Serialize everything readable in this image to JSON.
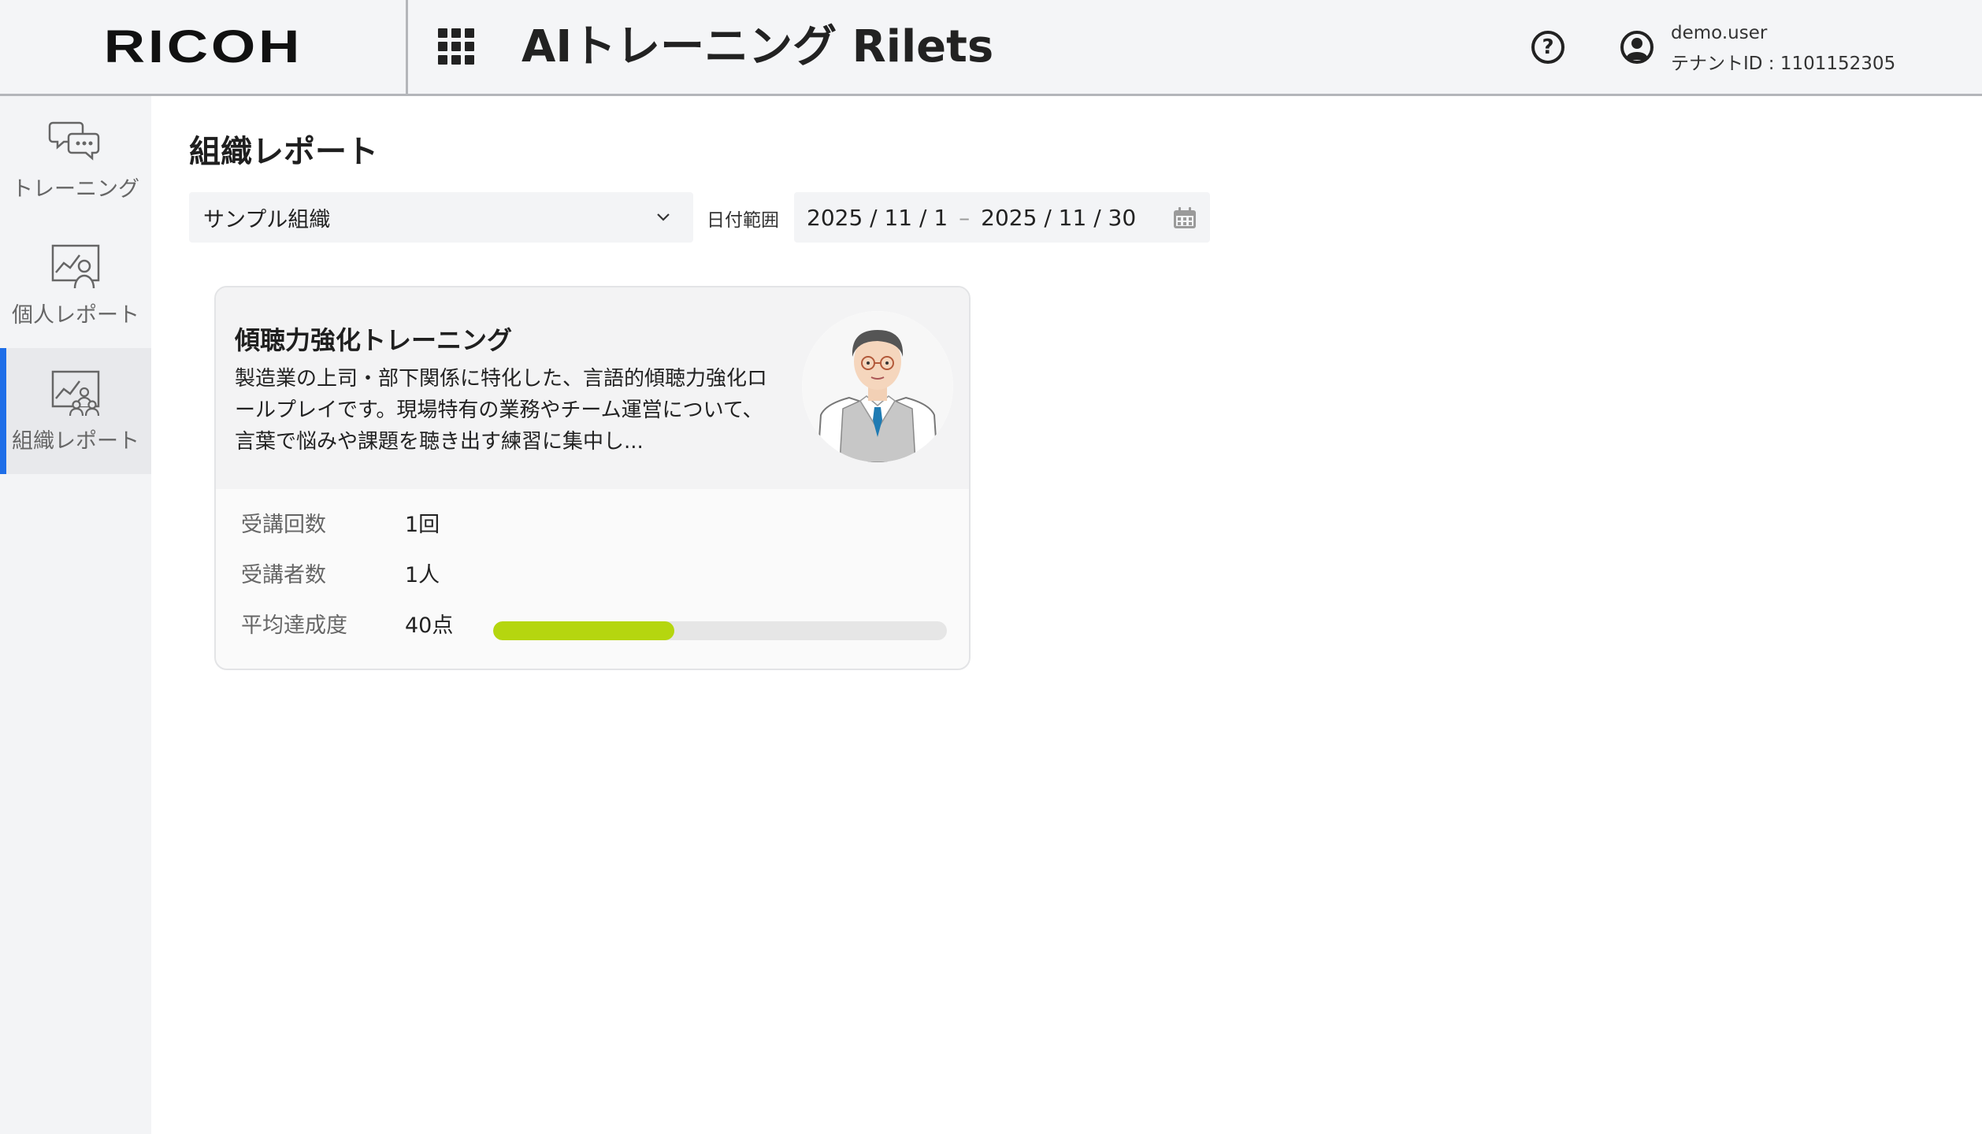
{
  "header": {
    "logo": "RICOH",
    "app_title": "AIトレーニング Rilets",
    "help_icon": "help-circle-icon",
    "user_icon": "user-circle-icon",
    "user_name": "demo.user",
    "tenant": "テナントID : 1101152305"
  },
  "sidebar": {
    "items": [
      {
        "label": "トレーニング",
        "icon": "chat-bubbles-icon",
        "active": false
      },
      {
        "label": "個人レポート",
        "icon": "personal-report-icon",
        "active": false
      },
      {
        "label": "組織レポート",
        "icon": "org-report-icon",
        "active": true
      }
    ]
  },
  "main": {
    "title": "組織レポート",
    "org_select": {
      "value": "サンプル組織"
    },
    "date_label": "日付範囲",
    "date_range": {
      "start": "2025 / 11 / 1",
      "separator": "–",
      "end": "2025 / 11 / 30"
    },
    "card": {
      "title": "傾聴力強化トレーニング",
      "description": "製造業の上司・部下関係に特化した、言語的傾聴力強化ロールプレイです。現場特有の業務やチーム運営について、言葉で悩みや課題を聴き出す練習に集中し...",
      "stats": [
        {
          "label": "受講回数",
          "value": "1回"
        },
        {
          "label": "受講者数",
          "value": "1人"
        },
        {
          "label": "平均達成度",
          "value": "40点"
        }
      ],
      "avg_score_fraction": 0.4
    }
  },
  "colors": {
    "accent": "#1e6ee8",
    "progress": "#b5d60f",
    "header_bg": "#f4f5f7",
    "sidebar_bg": "#f3f4f6"
  }
}
